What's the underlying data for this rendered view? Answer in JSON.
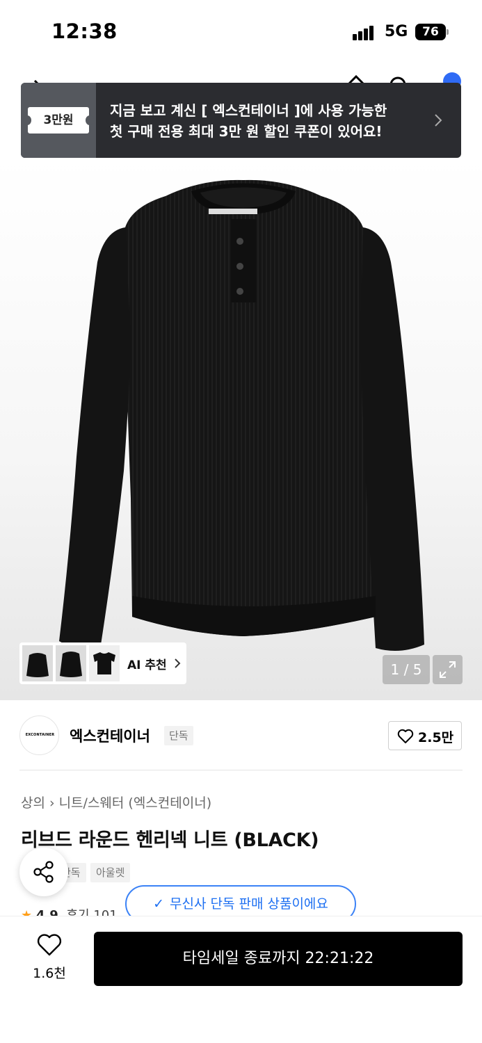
{
  "status_bar": {
    "time": "12:38",
    "network": "5G",
    "battery": "76"
  },
  "coupon": {
    "ticket_label": "3만원",
    "line1": "지금 보고 계신 [ 엑스컨테이너 ]에 사용 가능한",
    "line2": "첫 구매 전용 최대 3만 원 할인 쿠폰이 있어요!",
    "arrow_icon": "chevron-right-icon"
  },
  "gallery": {
    "ai_recommend_label": "AI 추천",
    "counter": "1 / 5",
    "expand_icon": "expand-icon"
  },
  "brand": {
    "logo_text": "EXCONTAINER",
    "name": "엑스컨테이너",
    "badge": "단독",
    "like_count": "2.5만"
  },
  "product": {
    "breadcrumb": [
      "상의",
      "니트/스웨터 (엑스컨테이너)"
    ],
    "title": "리브드 라운드 헨리넥 니트 (BLACK)",
    "tags": [
      "단독",
      "아울렛"
    ],
    "rating": "4.9",
    "review_text": "후기 101"
  },
  "exclusive_notice": "무신사 단독 판매 상품이에요",
  "bottom": {
    "wish_count": "1.6천",
    "buy_label": "타임세일 종료까지 22:21:22"
  },
  "colors": {
    "accent_blue": "#1d6ff2",
    "star": "#ff9f1a",
    "dark_banner": "#2b2c30"
  }
}
